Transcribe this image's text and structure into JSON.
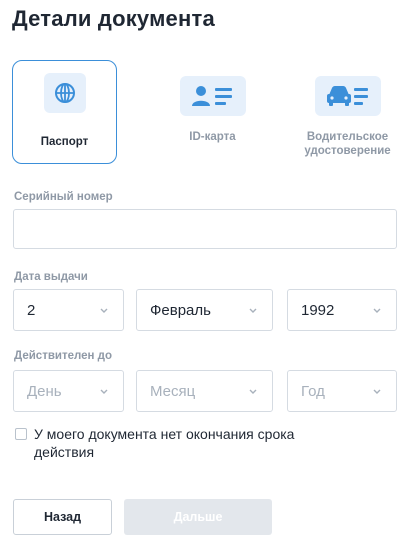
{
  "page_title": "Детали документа",
  "document_types": [
    {
      "label": "Паспорт",
      "icon": "globe-icon",
      "selected": true
    },
    {
      "label": "ID-карта",
      "icon": "id-card-icon",
      "selected": false
    },
    {
      "label_line1": "Водительское",
      "label_line2": "удостоверение",
      "icon": "car-icon",
      "selected": false
    }
  ],
  "serial_number": {
    "label": "Серийный номер",
    "value": ""
  },
  "issue_date": {
    "label": "Дата выдачи",
    "day": "2",
    "month": "Февраль",
    "year": "1992"
  },
  "valid_until": {
    "label": "Действителен до",
    "day_placeholder": "День",
    "month_placeholder": "Месяц",
    "year_placeholder": "Год"
  },
  "no_expiry": {
    "label": "У моего документа нет окончания срока действия",
    "checked": false
  },
  "buttons": {
    "back": "Назад",
    "next": "Дальше"
  },
  "colors": {
    "accent": "#3b8fd9",
    "icon_bg": "#e6f0fb",
    "disabled": "#e3e7ec"
  }
}
